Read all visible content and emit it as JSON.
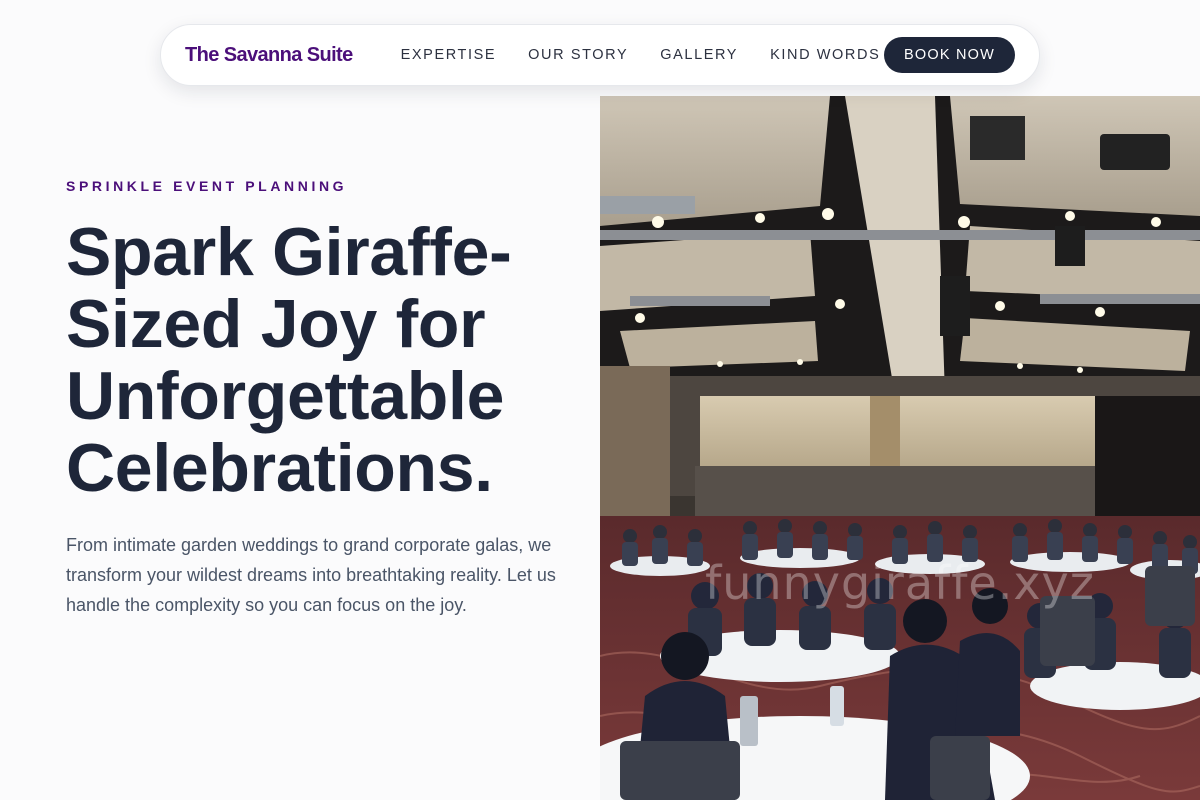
{
  "brand": {
    "name": "The Savanna Suite"
  },
  "nav": {
    "links": [
      "EXPERTISE",
      "OUR STORY",
      "GALLERY",
      "KIND WORDS"
    ],
    "cta": "BOOK NOW"
  },
  "hero": {
    "eyebrow": "SPRINKLE EVENT PLANNING",
    "headline": "Spark Giraffe-Sized Joy for Unforgettable Celebrations.",
    "lede": "From intimate garden weddings to grand corporate galas, we transform your wildest dreams into breathtaking reality. Let us handle the complexity so you can focus on the joy.",
    "image": {
      "watermark": "funnygiraffe.xyz"
    }
  },
  "colors": {
    "brand": "#4b0f7a",
    "ink": "#1e2639",
    "body_text": "#4a5567",
    "button_bg": "#1e2639"
  }
}
